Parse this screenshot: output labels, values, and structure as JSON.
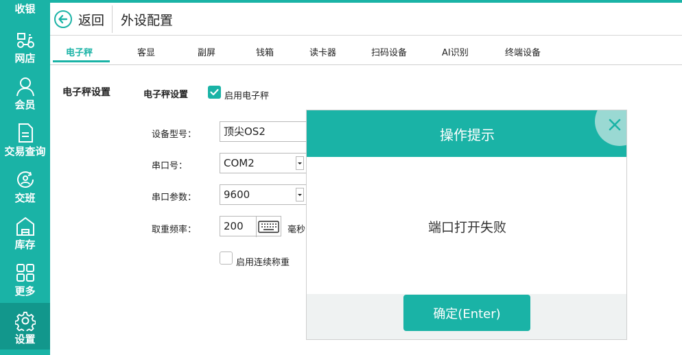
{
  "sidebar": {
    "top_label": "收银",
    "items": [
      {
        "label": "网店",
        "icon": "scooter-icon"
      },
      {
        "label": "会员",
        "icon": "person-icon"
      },
      {
        "label": "交易查询",
        "icon": "document-icon"
      },
      {
        "label": "交班",
        "icon": "shift-icon"
      },
      {
        "label": "库存",
        "icon": "warehouse-icon"
      },
      {
        "label": "更多",
        "icon": "grid-icon"
      },
      {
        "label": "设置",
        "icon": "gear-icon",
        "active": true
      }
    ]
  },
  "header": {
    "back_label": "返回",
    "title": "外设配置"
  },
  "tabs": [
    "电子秤",
    "客显",
    "副屏",
    "钱箱",
    "读卡器",
    "扫码设备",
    "AI识别",
    "终端设备"
  ],
  "form": {
    "section_title": "电子秤设置",
    "sub_title": "电子秤设置",
    "enable_scale_label": "启用电子秤",
    "enable_scale_checked": true,
    "device_model_label": "设备型号：",
    "device_model_value": "顶尖OS2",
    "port_label": "串口号：",
    "port_value": "COM2",
    "port_params_label": "串口参数：",
    "port_params_value": "9600",
    "freq_label": "取重频率：",
    "freq_value": "200",
    "freq_unit": "毫秒",
    "continuous_label": "启用连续称重",
    "continuous_checked": false
  },
  "dialog": {
    "title": "操作提示",
    "message": "端口打开失败",
    "ok_label": "确定(Enter)"
  },
  "colors": {
    "accent": "#1ab3a6",
    "accent_dark": "#12978c"
  }
}
